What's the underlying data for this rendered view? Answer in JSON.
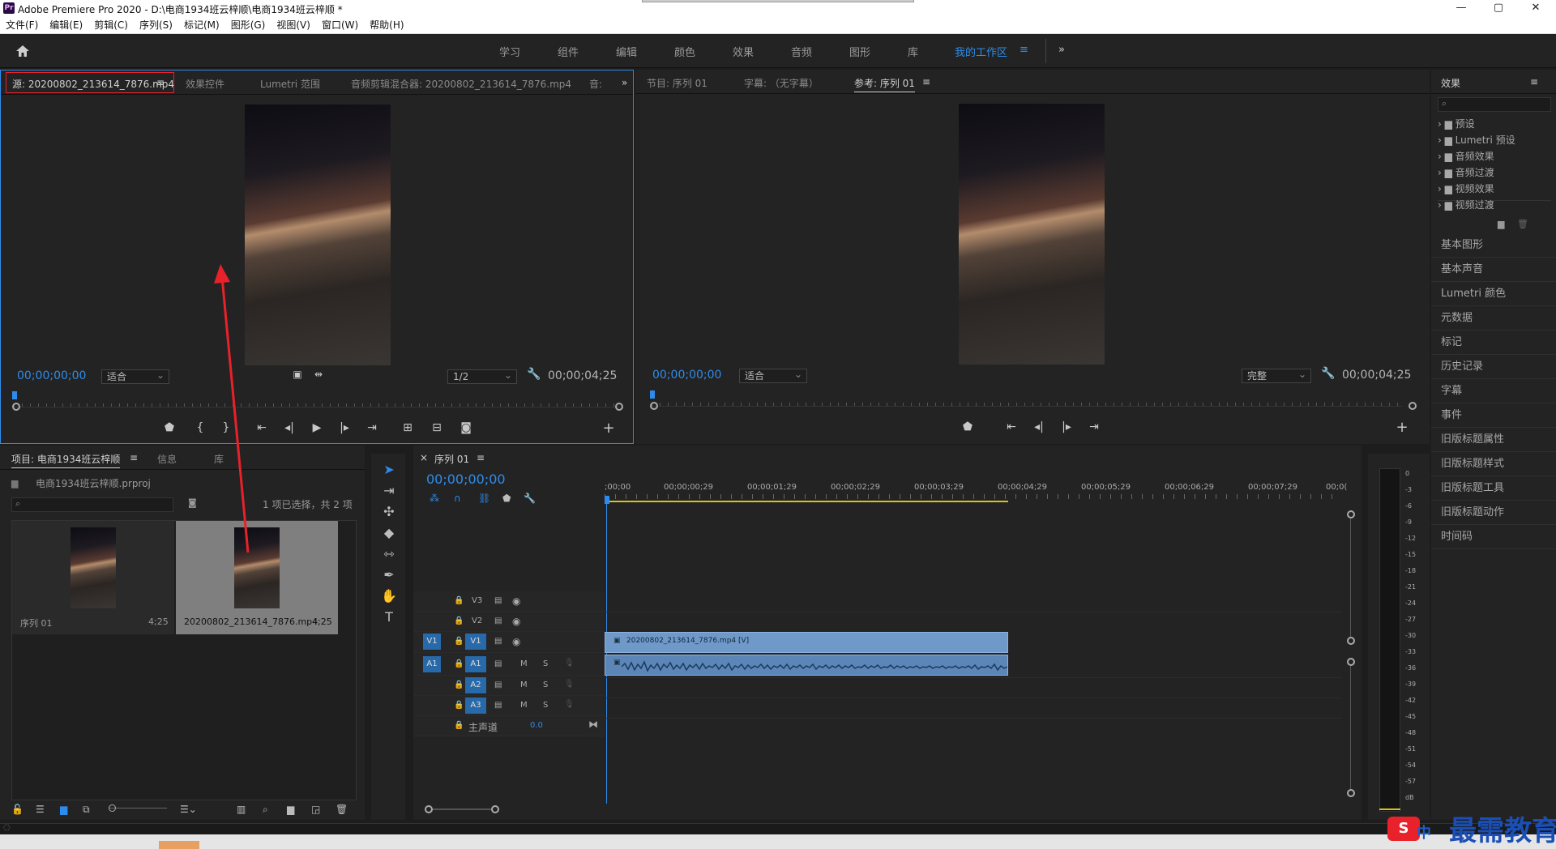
{
  "app": {
    "title": "Adobe Premiere Pro 2020 - D:\\电商1934班云梓顺\\电商1934班云梓顺 *",
    "logo": "Pr"
  },
  "window": {
    "minimize": "—",
    "maximize": "▢",
    "close": "✕"
  },
  "menu": [
    "文件(F)",
    "编辑(E)",
    "剪辑(C)",
    "序列(S)",
    "标记(M)",
    "图形(G)",
    "视图(V)",
    "窗口(W)",
    "帮助(H)"
  ],
  "workspaces": [
    "学习",
    "组件",
    "编辑",
    "颜色",
    "效果",
    "音频",
    "图形",
    "库",
    "我的工作区"
  ],
  "workspace_menu": "≡",
  "workspace_more": "»",
  "source": {
    "tabs": [
      "源: 20200802_213614_7876.mp4",
      "效果控件",
      "Lumetri 范围",
      "音频剪辑混合器: 20200802_213614_7876.mp4",
      "音:"
    ],
    "tab_menu": "≡",
    "more": "»",
    "timecode": "00;00;00;00",
    "fit": "适合",
    "resolution": "1/2",
    "duration": "00;00;04;25"
  },
  "program": {
    "tabs": [
      "节目: 序列 01",
      "字幕: （无字幕）",
      "参考: 序列 01"
    ],
    "tab_menu": "≡",
    "timecode": "00;00;00;00",
    "fit": "适合",
    "resolution": "完整",
    "duration": "00;00;04;25"
  },
  "effects": {
    "title": "效果",
    "menu": "≡",
    "items": [
      "预设",
      "Lumetri 预设",
      "音频效果",
      "音频过渡",
      "视频效果",
      "视频过渡"
    ],
    "panels": [
      "基本图形",
      "基本声音",
      "Lumetri 颜色",
      "元数据",
      "标记",
      "历史记录",
      "字幕",
      "事件",
      "旧版标题属性",
      "旧版标题样式",
      "旧版标题工具",
      "旧版标题动作",
      "时间码"
    ]
  },
  "project": {
    "tabs": [
      "项目: 电商1934班云梓顺",
      "信息",
      "库"
    ],
    "tab_menu": "≡",
    "file": "电商1934班云梓顺.prproj",
    "selection": "1 项已选择，共 2 项",
    "items": [
      {
        "name": "序列 01",
        "duration": "4;25"
      },
      {
        "name": "20200802_213614_7876.mp4",
        "duration": "4;25"
      }
    ]
  },
  "timeline": {
    "tab": "序列 01",
    "close": "×",
    "menu": "≡",
    "timecode": "00;00;00;00",
    "ticks": [
      ";00;00",
      "00;00;00;29",
      "00;00;01;29",
      "00;00;02;29",
      "00;00;03;29",
      "00;00;04;29",
      "00;00;05;29",
      "00;00;06;29",
      "00;00;07;29",
      "00;0("
    ],
    "tracks": {
      "v": [
        {
          "name": "V3"
        },
        {
          "name": "V2"
        },
        {
          "src": "V1",
          "name": "V1"
        }
      ],
      "a": [
        {
          "src": "A1",
          "name": "A1"
        },
        {
          "name": "A2"
        },
        {
          "name": "A3"
        }
      ],
      "master": "主声道",
      "master_val": "0.0",
      "m": "M",
      "s": "S"
    },
    "clip_label": "20200802_213614_7876.mp4 [V]"
  },
  "meter": {
    "labels": [
      "0",
      "-3",
      "-6",
      "-9",
      "-12",
      "-15",
      "-18",
      "-21",
      "-24",
      "-27",
      "-30",
      "-33",
      "-36",
      "-39",
      "-42",
      "-45",
      "-48",
      "-51",
      "-54",
      "-57",
      "dB"
    ]
  },
  "watermark": {
    "ime": "中",
    "text": "最需教育"
  },
  "colors": {
    "accent": "#2d8ceb",
    "clip": "#6f99c9",
    "highlight": "#e8212a"
  }
}
